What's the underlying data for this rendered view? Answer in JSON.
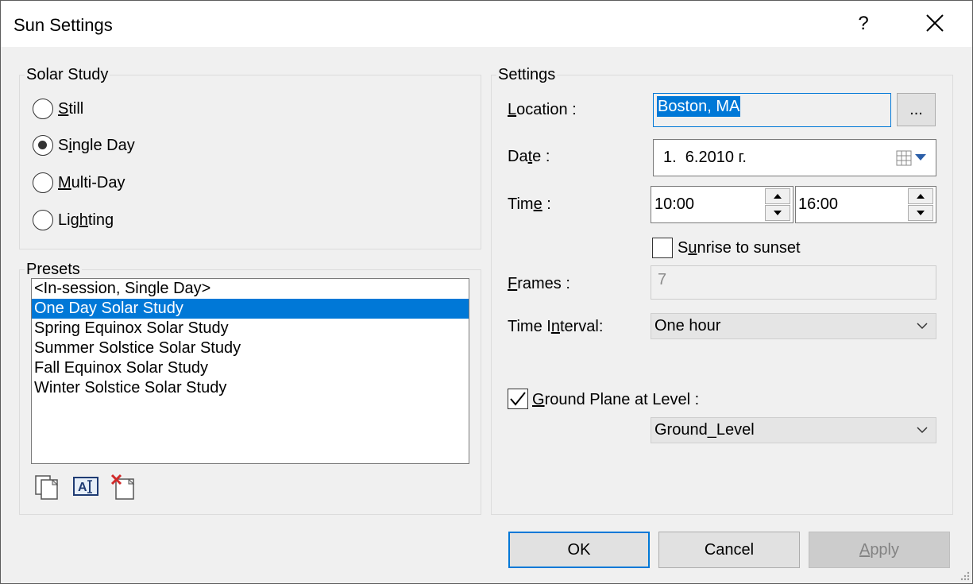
{
  "window": {
    "title": "Sun Settings",
    "help_label": "?"
  },
  "solar_study": {
    "group_label": "Solar Study",
    "options": [
      {
        "label": "Still",
        "accel": "S",
        "rest": "till",
        "checked": false
      },
      {
        "label": "Single Day",
        "pre": "S",
        "accel": "i",
        "rest": "ngle Day",
        "checked": true
      },
      {
        "label": "Multi-Day",
        "accel": "M",
        "rest": "ulti-Day",
        "checked": false
      },
      {
        "label": "Lighting",
        "pre": "Lig",
        "accel": "h",
        "rest": "ting",
        "checked": false
      }
    ]
  },
  "presets": {
    "group_label": "Presets",
    "items": [
      "<In-session, Single Day>",
      "One Day Solar Study",
      "Spring Equinox Solar Study",
      "Summer Solstice Solar Study",
      "Fall Equinox Solar Study",
      "Winter Solstice Solar Study"
    ],
    "selected_index": 1,
    "toolbar_icons": [
      "duplicate-preset-icon",
      "rename-preset-icon",
      "delete-preset-icon"
    ]
  },
  "settings": {
    "group_label": "Settings",
    "location": {
      "label_accel": "L",
      "label_rest": "ocation :",
      "value": "Boston, MA",
      "browse_label": "..."
    },
    "date": {
      "label_pre": "Da",
      "label_accel": "t",
      "label_rest": "e :",
      "value": "1.  6.2010 г.",
      "icon": "calendar-dropdown-icon"
    },
    "time": {
      "label_pre": "Tim",
      "label_accel": "e",
      "label_rest": " :",
      "start": "10:00",
      "end": "16:00"
    },
    "sunrise": {
      "label_pre": "S",
      "label_accel": "u",
      "label_rest": "nrise to sunset",
      "checked": false
    },
    "frames": {
      "label_accel": "F",
      "label_rest": "rames :",
      "value": "7"
    },
    "interval": {
      "label_pre": "Time I",
      "label_accel": "n",
      "label_rest": "terval:",
      "value": "One hour"
    },
    "ground_plane": {
      "label_accel": "G",
      "label_rest": "round Plane at Level :",
      "checked": true,
      "value": "Ground_Level"
    }
  },
  "buttons": {
    "ok": "OK",
    "cancel": "Cancel",
    "apply_accel": "A",
    "apply_rest": "pply"
  },
  "colors": {
    "accent": "#0078d7",
    "background": "#f0f0f0"
  }
}
